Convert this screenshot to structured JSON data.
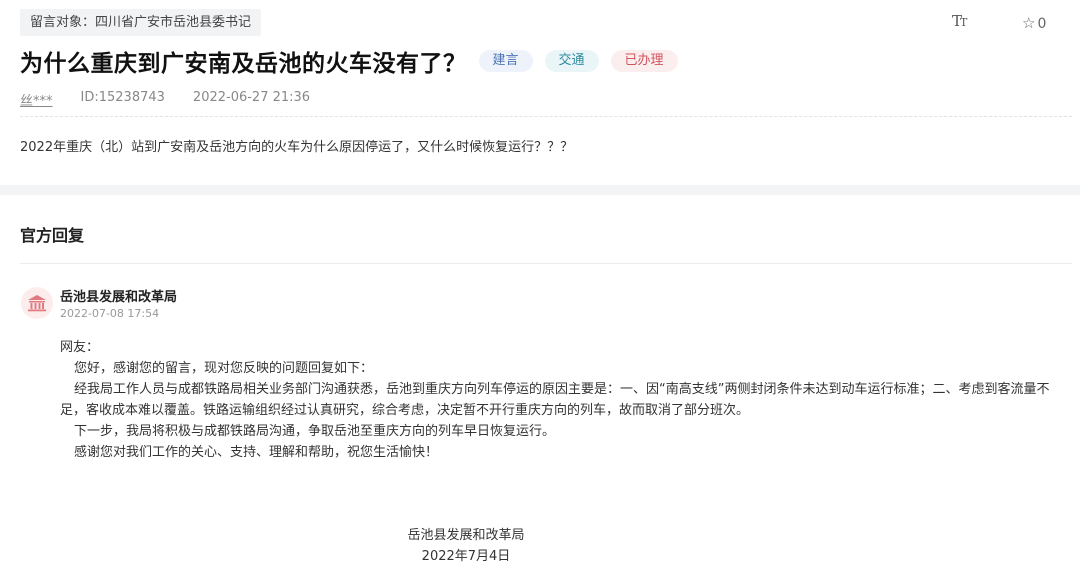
{
  "header": {
    "target_label": "留言对象：四川省广安市岳池县委书记",
    "font_size_icon": "text-size-icon",
    "favorite_count": "0",
    "favorite_icon": "star-icon"
  },
  "message": {
    "title": "为什么重庆到广安南及岳池的火车没有了？",
    "tags": [
      "建言",
      "交通",
      "已办理"
    ],
    "tag_colors": {
      "建言": "#4d74b6",
      "交通": "#2f8a9e",
      "已办理": "#d0545c"
    },
    "user": "丝***",
    "id": "ID:15238743",
    "time": "2022-06-27 21:36",
    "content": "2022年重庆（北）站到广安南及岳池方向的火车为什么原因停运了，又什么时候恢复运行？？？"
  },
  "reply": {
    "heading": "官方回复",
    "dept_icon": "government-building-icon",
    "department": "岳池县发展和改革局",
    "time": "2022-07-08 17:54",
    "paragraphs": [
      "网友：",
      "您好，感谢您的留言，现对您反映的问题回复如下：",
      "经我局工作人员与成都铁路局相关业务部门沟通获悉，岳池到重庆方向列车停运的原因主要是：一、因“南高支线”两侧封闭条件未达到动车运行标准；二、考虑到客流量不足，客收成本难以覆盖。铁路运输组织经过认真研究，综合考虑，决定暂不开行重庆方向的列车，故而取消了部分班次。",
      "下一步，我局将积极与成都铁路局沟通，争取岳池至重庆方向的列车早日恢复运行。",
      "感谢您对我们工作的关心、支持、理解和帮助，祝您生活愉快！"
    ],
    "signature": "岳池县发展和改革局",
    "signature_date": "2022年7月4日"
  }
}
